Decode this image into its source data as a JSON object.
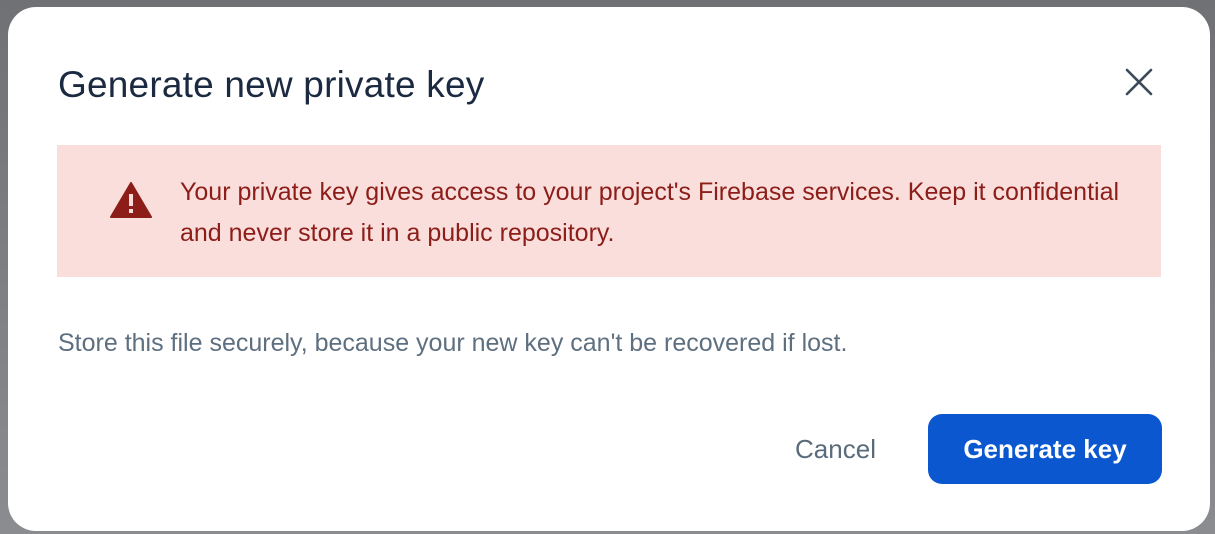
{
  "dialog": {
    "title": "Generate new private key",
    "close_icon": "close-icon",
    "warning": {
      "icon": "warning-icon",
      "text": "Your private key gives access to your project's Firebase services. Keep it confidential and never store it in a public repository."
    },
    "info": "Store this file securely, because your new key can't be recovered if lost.",
    "actions": {
      "cancel_label": "Cancel",
      "generate_label": "Generate key"
    }
  },
  "colors": {
    "title": "#1b2a40",
    "warning_bg": "#f9dedc",
    "warning_text": "#8c1d18",
    "warning_icon": "#8c1d18",
    "info_text": "#5e6f80",
    "primary_button": "#0b57d0",
    "cancel_text": "#5a6b7c"
  }
}
